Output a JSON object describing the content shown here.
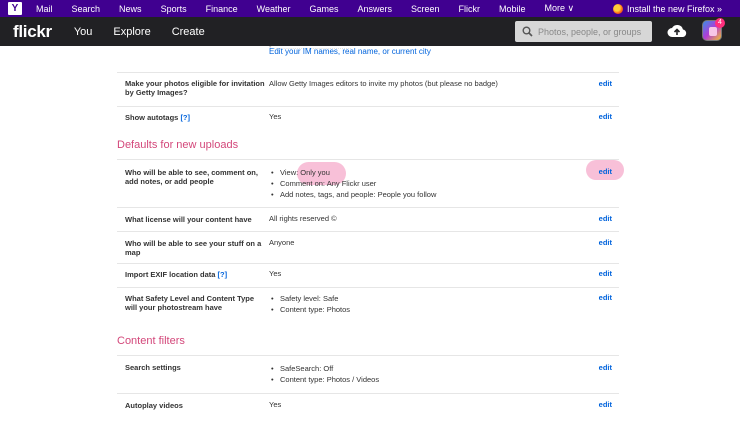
{
  "yahoo_bar": {
    "logo": "Y",
    "links": [
      "Mail",
      "Search",
      "News",
      "Sports",
      "Finance",
      "Weather",
      "Games",
      "Answers",
      "Screen",
      "Flickr",
      "Mobile",
      "More ∨"
    ],
    "promo": "Install the new Firefox »"
  },
  "flickr_bar": {
    "logo": "flickr",
    "nav": [
      "You",
      "Explore",
      "Create"
    ],
    "search_placeholder": "Photos, people, or groups",
    "notification_count": "4"
  },
  "top_link": "Edit your IM names, real name, or current city",
  "rows_top": [
    {
      "label": "Make your photos eligible for invitation by Getty Images?",
      "value": "Allow Getty Images editors to invite my photos (but please no badge)",
      "edit": "edit"
    },
    {
      "label": "Show autotags",
      "help": "[?]",
      "value": "Yes",
      "edit": "edit"
    }
  ],
  "section_uploads": {
    "title": "Defaults for new uploads",
    "rows": [
      {
        "label": "Who will be able to see, comment on, add notes, or add people",
        "items": [
          "View: Only you",
          "Comment on: Any Flickr user",
          "Add notes, tags, and people: People you follow"
        ],
        "edit": "edit"
      },
      {
        "label": "What license will your content have",
        "value": "All rights reserved ©",
        "edit": "edit"
      },
      {
        "label": "Who will be able to see your stuff on a map",
        "value": "Anyone",
        "edit": "edit"
      },
      {
        "label": "Import EXIF location data",
        "help": "[?]",
        "value": "Yes",
        "edit": "edit"
      },
      {
        "label": "What Safety Level and Content Type will your photostream have",
        "items": [
          "Safety level: Safe",
          "Content type: Photos"
        ],
        "edit": "edit"
      }
    ]
  },
  "section_filters": {
    "title": "Content filters",
    "rows": [
      {
        "label": "Search settings",
        "items": [
          "SafeSearch: Off",
          "Content type: Photos / Videos"
        ],
        "edit": "edit"
      },
      {
        "label": "Autoplay videos",
        "value": "Yes",
        "edit": "edit"
      }
    ]
  },
  "colors": {
    "yahoo_purple": "#400090",
    "flickr_bar": "#212124",
    "section_pink": "#d3477a",
    "link_blue": "#0063dc",
    "highlight": "#f7b5d1"
  }
}
